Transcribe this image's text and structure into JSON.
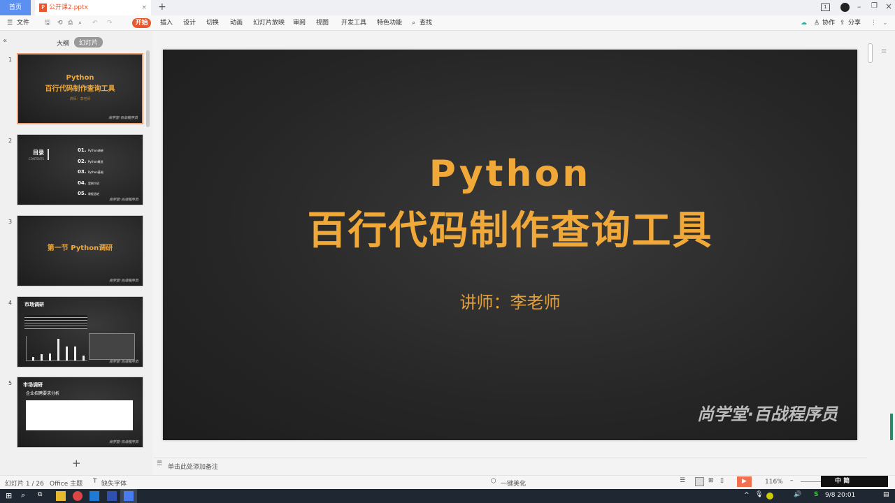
{
  "tabs": {
    "home": "首页",
    "file": "公开课2.pptx",
    "new": "+"
  },
  "window": {
    "page_icon": "1"
  },
  "toolbar": {
    "file_menu": "文件",
    "items": [
      "开始",
      "插入",
      "设计",
      "切换",
      "动画",
      "幻灯片放映",
      "审阅",
      "视图",
      "开发工具",
      "特色功能"
    ],
    "search": "查找",
    "collab": "协作",
    "share": "分享"
  },
  "panel": {
    "outline": "大纲",
    "slides": "幻灯片",
    "collapse": "«",
    "add": "+"
  },
  "thumbs": {
    "s1": {
      "title1": "Python",
      "title2": "百行代码制作查询工具",
      "sub": "讲师：李老师",
      "logo": "尚学堂·百战程序员"
    },
    "s2": {
      "title": "目录",
      "sub": "CONTENTS",
      "items": [
        "01.",
        "02.",
        "03.",
        "04.",
        "05."
      ],
      "labels": [
        "Python调研",
        "Python概览",
        "Python基础",
        "案例介绍",
        "课程总结"
      ]
    },
    "s3": {
      "title": "第一节 Python调研"
    },
    "s4": {
      "title": "市场调研"
    },
    "s5": {
      "title": "市场调研",
      "sub": "企业招聘要求分析"
    }
  },
  "slide": {
    "title1": "Python",
    "title2": "百行代码制作查询工具",
    "lecturer": "讲师：李老师",
    "logo": "尚学堂·百战程序员"
  },
  "notes": {
    "placeholder": "单击此处添加备注"
  },
  "status": {
    "slide_count": "幻灯片 1 / 26",
    "theme": "Office 主题",
    "missing_font": "缺失字体",
    "beautify": "一键美化",
    "zoom": "116%",
    "ime": "中 简"
  },
  "taskbar": {
    "clock": "9/8 20:01"
  }
}
